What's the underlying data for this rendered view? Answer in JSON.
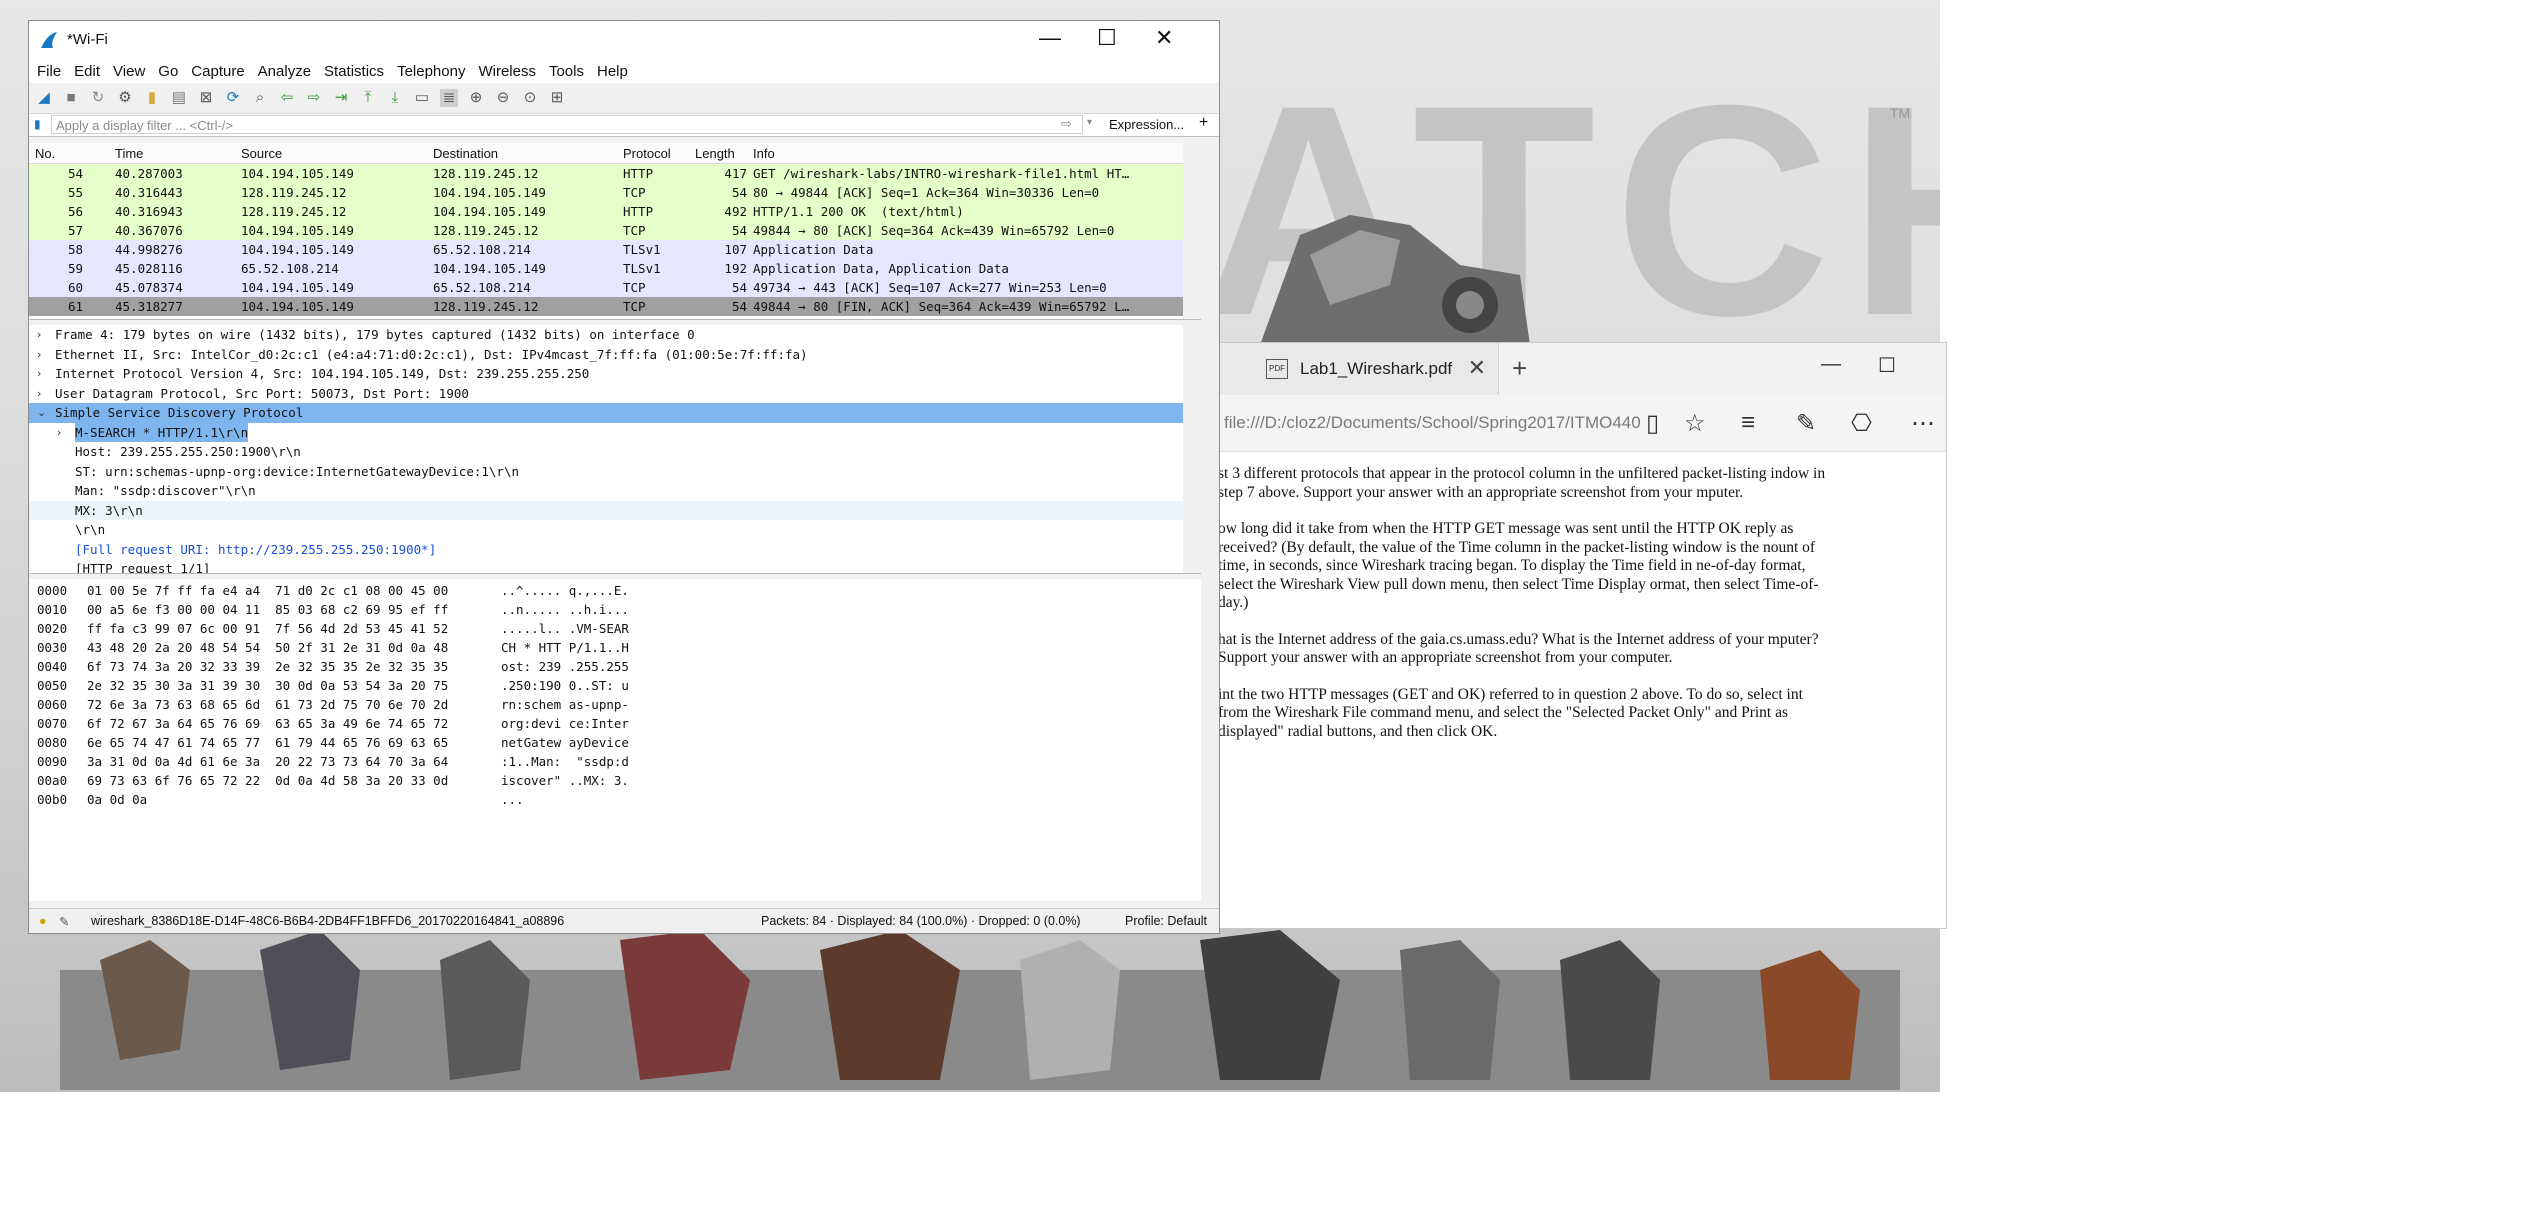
{
  "wallpaper": {
    "brand": "ATCH",
    "tm": "TM"
  },
  "pdf_viewer": {
    "tab_title": "Lab1_Wireshark.pdf",
    "address": "file:///D:/cloz2/Documents/School/Spring2017/ITMO440",
    "paragraphs": [
      "st 3 different protocols that appear in the protocol column in the unfiltered packet-listing indow in step 7 above. Support your answer with an appropriate screenshot from your mputer.",
      "ow long did it take from when the HTTP GET message was sent until the HTTP OK reply as received? (By default, the value of the Time column in the packet-listing window is the nount of time, in seconds, since Wireshark tracing began. To display the Time field in ne-of-day format, select the Wireshark View pull down menu, then select Time Display ormat, then select Time-of-day.)",
      "hat is the Internet address of the gaia.cs.umass.edu? What is the Internet address of your mputer?  Support your answer with an appropriate screenshot from your computer.",
      "int the two HTTP messages (GET and OK) referred to in question 2 above. To do so, select int from the Wireshark File command menu, and select the \"Selected Packet Only\" and Print as displayed\" radial buttons, and then click OK."
    ]
  },
  "wireshark": {
    "title": "*Wi-Fi",
    "menu": [
      "File",
      "Edit",
      "View",
      "Go",
      "Capture",
      "Analyze",
      "Statistics",
      "Telephony",
      "Wireless",
      "Tools",
      "Help"
    ],
    "filter_placeholder": "Apply a display filter ... <Ctrl-/>",
    "expression_label": "Expression...",
    "plus_label": "+",
    "columns": {
      "no": "No.",
      "time": "Time",
      "source": "Source",
      "destination": "Destination",
      "protocol": "Protocol",
      "length": "Length",
      "info": "Info"
    },
    "packets": [
      {
        "no": "54",
        "time": "40.287003",
        "src": "104.194.105.149",
        "dst": "128.119.245.12",
        "proto": "HTTP",
        "len": "417",
        "info": "GET /wireshark-labs/INTRO-wireshark-file1.html HT…",
        "bg": "#e4ffc7"
      },
      {
        "no": "55",
        "time": "40.316443",
        "src": "128.119.245.12",
        "dst": "104.194.105.149",
        "proto": "TCP",
        "len": "54",
        "info": "80 → 49844 [ACK] Seq=1 Ack=364 Win=30336 Len=0",
        "bg": "#e4ffc7"
      },
      {
        "no": "56",
        "time": "40.316943",
        "src": "128.119.245.12",
        "dst": "104.194.105.149",
        "proto": "HTTP",
        "len": "492",
        "info": "HTTP/1.1 200 OK  (text/html)",
        "bg": "#e4ffc7"
      },
      {
        "no": "57",
        "time": "40.367076",
        "src": "104.194.105.149",
        "dst": "128.119.245.12",
        "proto": "TCP",
        "len": "54",
        "info": "49844 → 80 [ACK] Seq=364 Ack=439 Win=65792 Len=0",
        "bg": "#e4ffc7"
      },
      {
        "no": "58",
        "time": "44.998276",
        "src": "104.194.105.149",
        "dst": "65.52.108.214",
        "proto": "TLSv1",
        "len": "107",
        "info": "Application Data",
        "bg": "#e7e6ff"
      },
      {
        "no": "59",
        "time": "45.028116",
        "src": "65.52.108.214",
        "dst": "104.194.105.149",
        "proto": "TLSv1",
        "len": "192",
        "info": "Application Data, Application Data",
        "bg": "#e7e6ff"
      },
      {
        "no": "60",
        "time": "45.078374",
        "src": "104.194.105.149",
        "dst": "65.52.108.214",
        "proto": "TCP",
        "len": "54",
        "info": "49734 → 443 [ACK] Seq=107 Ack=277 Win=253 Len=0",
        "bg": "#e7e6ff"
      },
      {
        "no": "61",
        "time": "45.318277",
        "src": "104.194.105.149",
        "dst": "128.119.245.12",
        "proto": "TCP",
        "len": "54",
        "info": "49844 → 80 [FIN, ACK] Seq=364 Ack=439 Win=65792 L…",
        "bg": "#a0a0a0"
      }
    ],
    "details": [
      {
        "text": "Frame 4: 179 bytes on wire (1432 bits), 179 bytes captured (1432 bits) on interface 0",
        "level": 0,
        "arrow": "›",
        "selected": false
      },
      {
        "text": "Ethernet II, Src: IntelCor_d0:2c:c1 (e4:a4:71:d0:2c:c1), Dst: IPv4mcast_7f:ff:fa (01:00:5e:7f:ff:fa)",
        "level": 0,
        "arrow": "›",
        "selected": false
      },
      {
        "text": "Internet Protocol Version 4, Src: 104.194.105.149, Dst: 239.255.255.250",
        "level": 0,
        "arrow": "›",
        "selected": false
      },
      {
        "text": "User Datagram Protocol, Src Port: 50073, Dst Port: 1900",
        "level": 0,
        "arrow": "›",
        "selected": false
      },
      {
        "text": "Simple Service Discovery Protocol",
        "level": 0,
        "arrow": "⌄",
        "selected": true
      },
      {
        "text": "M-SEARCH * HTTP/1.1\\r\\n",
        "level": 1,
        "arrow": "›",
        "selected": false
      },
      {
        "text": "Host: 239.255.255.250:1900\\r\\n",
        "level": 1,
        "arrow": "",
        "selected": false
      },
      {
        "text": "ST: urn:schemas-upnp-org:device:InternetGatewayDevice:1\\r\\n",
        "level": 1,
        "arrow": "",
        "selected": false
      },
      {
        "text": "Man: \"ssdp:discover\"\\r\\n",
        "level": 1,
        "arrow": "",
        "selected": false
      },
      {
        "text": "MX: 3\\r\\n",
        "level": 1,
        "arrow": "",
        "selected": false
      },
      {
        "text": "\\r\\n",
        "level": 1,
        "arrow": "",
        "selected": false
      },
      {
        "text": "[Full request URI: http://239.255.255.250:1900*]",
        "level": 1,
        "arrow": "",
        "selected": false
      },
      {
        "text": "[HTTP request 1/1]",
        "level": 1,
        "arrow": "",
        "selected": false
      }
    ],
    "bytes": [
      {
        "off": "0000",
        "hex": "01 00 5e 7f ff fa e4 a4  71 d0 2c c1 08 00 45 00",
        "asc": "..^..... q.,...E."
      },
      {
        "off": "0010",
        "hex": "00 a5 6e f3 00 00 04 11  85 03 68 c2 69 95 ef ff",
        "asc": "..n..... ..h.i..."
      },
      {
        "off": "0020",
        "hex": "ff fa c3 99 07 6c 00 91  7f 56 4d 2d 53 45 41 52",
        "asc": ".....l.. .VM-SEAR"
      },
      {
        "off": "0030",
        "hex": "43 48 20 2a 20 48 54 54  50 2f 31 2e 31 0d 0a 48",
        "asc": "CH * HTT P/1.1..H"
      },
      {
        "off": "0040",
        "hex": "6f 73 74 3a 20 32 33 39  2e 32 35 35 2e 32 35 35",
        "asc": "ost: 239 .255.255"
      },
      {
        "off": "0050",
        "hex": "2e 32 35 30 3a 31 39 30  30 0d 0a 53 54 3a 20 75",
        "asc": ".250:190 0..ST: u"
      },
      {
        "off": "0060",
        "hex": "72 6e 3a 73 63 68 65 6d  61 73 2d 75 70 6e 70 2d",
        "asc": "rn:schem as-upnp-"
      },
      {
        "off": "0070",
        "hex": "6f 72 67 3a 64 65 76 69  63 65 3a 49 6e 74 65 72",
        "asc": "org:devi ce:Inter"
      },
      {
        "off": "0080",
        "hex": "6e 65 74 47 61 74 65 77  61 79 44 65 76 69 63 65",
        "asc": "netGatew ayDevice"
      },
      {
        "off": "0090",
        "hex": "3a 31 0d 0a 4d 61 6e 3a  20 22 73 73 64 70 3a 64",
        "asc": ":1..Man:  \"ssdp:d"
      },
      {
        "off": "00a0",
        "hex": "69 73 63 6f 76 65 72 22  0d 0a 4d 58 3a 20 33 0d",
        "asc": "iscover\" ..MX: 3."
      },
      {
        "off": "00b0",
        "hex": "0a 0d 0a",
        "asc": "..."
      }
    ],
    "status": {
      "file": "wireshark_8386D18E-D14F-48C6-B6B4-2DB4FF1BFFD6_20170220164841_a08896",
      "packets": "Packets: 84 · Displayed: 84 (100.0%) · Dropped: 0 (0.0%)",
      "profile": "Profile: Default"
    }
  }
}
